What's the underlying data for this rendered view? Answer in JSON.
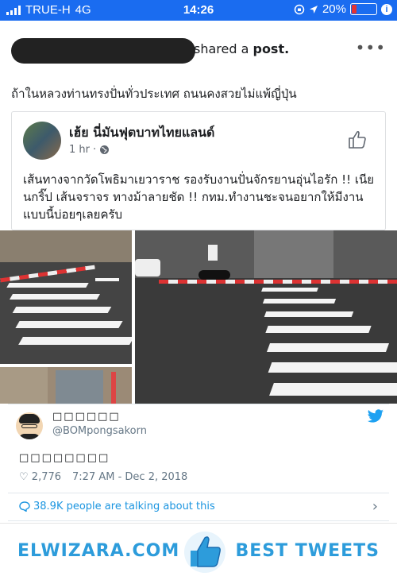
{
  "status_bar": {
    "carrier": "TRUE-H",
    "network": "4G",
    "time": "14:26",
    "battery": "20%",
    "battery_level": 0.2,
    "colors": {
      "bar": "#1a6cf0",
      "battery_low": "#e33333"
    }
  },
  "post": {
    "shared_text": "shared a ",
    "shared_bold": "post.",
    "more_icon": "ellipsis-icon",
    "caption": "ถ้าในหลวงท่านทรงปั่นทั่วประเทศ ถนนคงสวยไม่แพ้ญี่ปุ่น",
    "inner": {
      "page_name": "เฮ้ย นี่มันฟุตบาทไทยแลนด์",
      "time": "1 hr",
      "visibility_icon": "globe-icon",
      "like_icon": "thumbs-up-icon",
      "body": "เส้นทางจากวัดโพธิมาเยวาราช รองรับงานปั่นจักรยานอุ่นไอรัก !! เนียนกริ๊ป เส้นจราจร ทางม้าลายชัด !! กทม.ทำงานชะจนอยากให้มีงานแบบนี้บ่อยๆเลยครับ"
    }
  },
  "tweet": {
    "display_name": "□□□□□□",
    "handle": "@BOMpongsakorn",
    "text": "□□□□□□□□",
    "likes": "2,776",
    "timestamp": "7:27 AM - Dec 2, 2018",
    "talking": "38.9K people are talking about this",
    "colors": {
      "link": "#1b95e0",
      "muted": "#657786"
    }
  },
  "banner": {
    "left_text": "ELWIZARA.COM",
    "right_text": "BEST TWEETS",
    "icon": "thumbs-up-icon",
    "color": "#2d9cdb"
  }
}
